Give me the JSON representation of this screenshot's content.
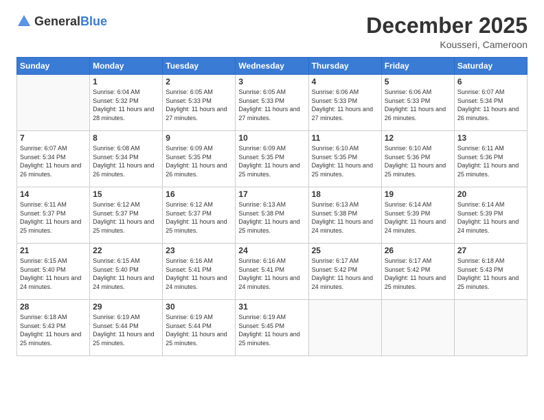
{
  "header": {
    "logo_general": "General",
    "logo_blue": "Blue",
    "title": "December 2025",
    "location": "Kousseri, Cameroon"
  },
  "days_of_week": [
    "Sunday",
    "Monday",
    "Tuesday",
    "Wednesday",
    "Thursday",
    "Friday",
    "Saturday"
  ],
  "weeks": [
    [
      {
        "day": "",
        "info": ""
      },
      {
        "day": "1",
        "info": "Sunrise: 6:04 AM\nSunset: 5:32 PM\nDaylight: 11 hours\nand 28 minutes."
      },
      {
        "day": "2",
        "info": "Sunrise: 6:05 AM\nSunset: 5:33 PM\nDaylight: 11 hours\nand 27 minutes."
      },
      {
        "day": "3",
        "info": "Sunrise: 6:05 AM\nSunset: 5:33 PM\nDaylight: 11 hours\nand 27 minutes."
      },
      {
        "day": "4",
        "info": "Sunrise: 6:06 AM\nSunset: 5:33 PM\nDaylight: 11 hours\nand 27 minutes."
      },
      {
        "day": "5",
        "info": "Sunrise: 6:06 AM\nSunset: 5:33 PM\nDaylight: 11 hours\nand 26 minutes."
      },
      {
        "day": "6",
        "info": "Sunrise: 6:07 AM\nSunset: 5:34 PM\nDaylight: 11 hours\nand 26 minutes."
      }
    ],
    [
      {
        "day": "7",
        "info": "Sunrise: 6:07 AM\nSunset: 5:34 PM\nDaylight: 11 hours\nand 26 minutes."
      },
      {
        "day": "8",
        "info": "Sunrise: 6:08 AM\nSunset: 5:34 PM\nDaylight: 11 hours\nand 26 minutes."
      },
      {
        "day": "9",
        "info": "Sunrise: 6:09 AM\nSunset: 5:35 PM\nDaylight: 11 hours\nand 26 minutes."
      },
      {
        "day": "10",
        "info": "Sunrise: 6:09 AM\nSunset: 5:35 PM\nDaylight: 11 hours\nand 25 minutes."
      },
      {
        "day": "11",
        "info": "Sunrise: 6:10 AM\nSunset: 5:35 PM\nDaylight: 11 hours\nand 25 minutes."
      },
      {
        "day": "12",
        "info": "Sunrise: 6:10 AM\nSunset: 5:36 PM\nDaylight: 11 hours\nand 25 minutes."
      },
      {
        "day": "13",
        "info": "Sunrise: 6:11 AM\nSunset: 5:36 PM\nDaylight: 11 hours\nand 25 minutes."
      }
    ],
    [
      {
        "day": "14",
        "info": "Sunrise: 6:11 AM\nSunset: 5:37 PM\nDaylight: 11 hours\nand 25 minutes."
      },
      {
        "day": "15",
        "info": "Sunrise: 6:12 AM\nSunset: 5:37 PM\nDaylight: 11 hours\nand 25 minutes."
      },
      {
        "day": "16",
        "info": "Sunrise: 6:12 AM\nSunset: 5:37 PM\nDaylight: 11 hours\nand 25 minutes."
      },
      {
        "day": "17",
        "info": "Sunrise: 6:13 AM\nSunset: 5:38 PM\nDaylight: 11 hours\nand 25 minutes."
      },
      {
        "day": "18",
        "info": "Sunrise: 6:13 AM\nSunset: 5:38 PM\nDaylight: 11 hours\nand 24 minutes."
      },
      {
        "day": "19",
        "info": "Sunrise: 6:14 AM\nSunset: 5:39 PM\nDaylight: 11 hours\nand 24 minutes."
      },
      {
        "day": "20",
        "info": "Sunrise: 6:14 AM\nSunset: 5:39 PM\nDaylight: 11 hours\nand 24 minutes."
      }
    ],
    [
      {
        "day": "21",
        "info": "Sunrise: 6:15 AM\nSunset: 5:40 PM\nDaylight: 11 hours\nand 24 minutes."
      },
      {
        "day": "22",
        "info": "Sunrise: 6:15 AM\nSunset: 5:40 PM\nDaylight: 11 hours\nand 24 minutes."
      },
      {
        "day": "23",
        "info": "Sunrise: 6:16 AM\nSunset: 5:41 PM\nDaylight: 11 hours\nand 24 minutes."
      },
      {
        "day": "24",
        "info": "Sunrise: 6:16 AM\nSunset: 5:41 PM\nDaylight: 11 hours\nand 24 minutes."
      },
      {
        "day": "25",
        "info": "Sunrise: 6:17 AM\nSunset: 5:42 PM\nDaylight: 11 hours\nand 24 minutes."
      },
      {
        "day": "26",
        "info": "Sunrise: 6:17 AM\nSunset: 5:42 PM\nDaylight: 11 hours\nand 25 minutes."
      },
      {
        "day": "27",
        "info": "Sunrise: 6:18 AM\nSunset: 5:43 PM\nDaylight: 11 hours\nand 25 minutes."
      }
    ],
    [
      {
        "day": "28",
        "info": "Sunrise: 6:18 AM\nSunset: 5:43 PM\nDaylight: 11 hours\nand 25 minutes."
      },
      {
        "day": "29",
        "info": "Sunrise: 6:19 AM\nSunset: 5:44 PM\nDaylight: 11 hours\nand 25 minutes."
      },
      {
        "day": "30",
        "info": "Sunrise: 6:19 AM\nSunset: 5:44 PM\nDaylight: 11 hours\nand 25 minutes."
      },
      {
        "day": "31",
        "info": "Sunrise: 6:19 AM\nSunset: 5:45 PM\nDaylight: 11 hours\nand 25 minutes."
      },
      {
        "day": "",
        "info": ""
      },
      {
        "day": "",
        "info": ""
      },
      {
        "day": "",
        "info": ""
      }
    ]
  ]
}
